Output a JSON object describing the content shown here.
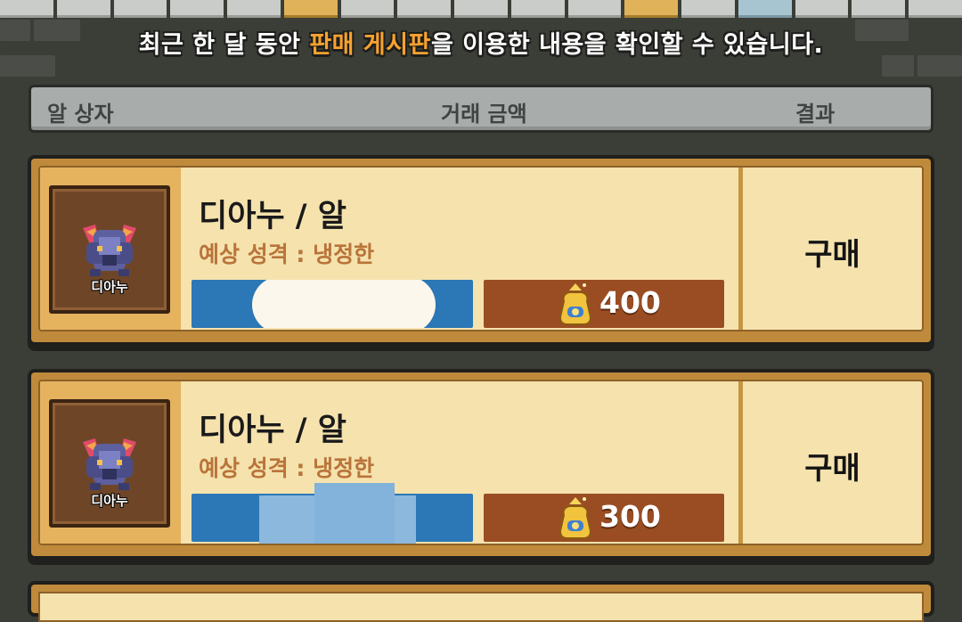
{
  "notice": {
    "prefix": "최근 한 달 동안 ",
    "highlight": "판매 게시판",
    "suffix": "을 이용한 내용을 확인할 수 있습니다."
  },
  "table_header": {
    "egg_box": "알 상자",
    "amount": "거래 금액",
    "result": "결과"
  },
  "entries": [
    {
      "thumb_label": "디아누",
      "title": "디아누 / 알",
      "personality": "예상 성격 : 냉정한",
      "price": "400",
      "result": "구매"
    },
    {
      "thumb_label": "디아누",
      "title": "디아누 / 알",
      "personality": "예상 성격 : 냉정한",
      "price": "300",
      "result": "구매"
    }
  ],
  "colors": {
    "highlight": "#f8a230",
    "seller_bar": "#2c77b5",
    "price_bar": "#9a4d22",
    "card_bg": "#f5e2ad"
  },
  "icons": {
    "creature": "dianu-creature-icon",
    "coin_bag": "coin-bag-icon"
  }
}
